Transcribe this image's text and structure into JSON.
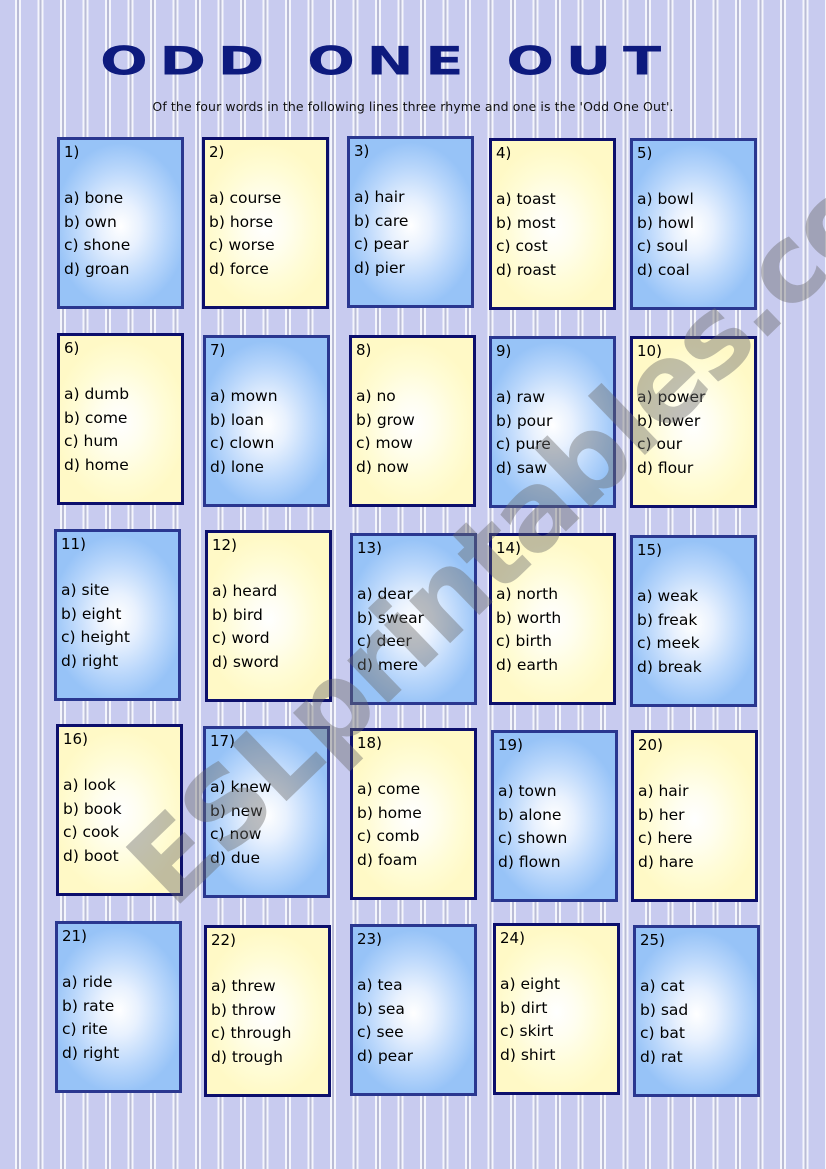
{
  "header": {
    "title": "ODD ONE OUT",
    "instructions": "Of the four words in the following lines three rhyme and one is the 'Odd One Out'."
  },
  "colors": {
    "title": "#0d1a7e",
    "blue_card_border": "#2a3790",
    "yellow_card_border": "#0c0f6c",
    "blue_card_fill": "#97c3f7",
    "yellow_card_fill": "#fff9c6",
    "background": "#c8cbef"
  },
  "watermark": "ESLprintables.com",
  "cards": [
    {
      "number": "1)",
      "style": "blue",
      "options": [
        "a) bone",
        "b) own",
        "c) shone",
        "d) groan"
      ]
    },
    {
      "number": "2)",
      "style": "yellow",
      "options": [
        "a) course",
        "b) horse",
        "c) worse",
        "d) force"
      ]
    },
    {
      "number": "3)",
      "style": "blue",
      "options": [
        "a) hair",
        "b) care",
        "c) pear",
        "d) pier"
      ]
    },
    {
      "number": "4)",
      "style": "yellow",
      "options": [
        "a) toast",
        "b) most",
        "c) cost",
        "d) roast"
      ]
    },
    {
      "number": "5)",
      "style": "blue",
      "options": [
        "a) bowl",
        "b) howl",
        "c) soul",
        "d) coal"
      ]
    },
    {
      "number": "6)",
      "style": "yellow",
      "options": [
        "a) dumb",
        "b) come",
        "c) hum",
        "d) home"
      ]
    },
    {
      "number": "7)",
      "style": "blue",
      "options": [
        "a) mown",
        "b) loan",
        "c) clown",
        "d) lone"
      ]
    },
    {
      "number": "8)",
      "style": "yellow",
      "options": [
        "a) no",
        "b) grow",
        "c) mow",
        "d) now"
      ]
    },
    {
      "number": "9)",
      "style": "blue",
      "options": [
        "a) raw",
        "b) pour",
        "c) pure",
        "d) saw"
      ]
    },
    {
      "number": "10)",
      "style": "yellow",
      "options": [
        "a) power",
        "b) lower",
        "c) our",
        "d) flour"
      ]
    },
    {
      "number": "11)",
      "style": "blue",
      "options": [
        "a) site",
        "b) eight",
        "c) height",
        "d) right"
      ]
    },
    {
      "number": "12)",
      "style": "yellow",
      "options": [
        "a) heard",
        "b) bird",
        "c) word",
        "d) sword"
      ]
    },
    {
      "number": "13)",
      "style": "blue",
      "options": [
        "a) dear",
        "b) swear",
        "c) deer",
        "d) mere"
      ]
    },
    {
      "number": "14)",
      "style": "yellow",
      "options": [
        "a) north",
        "b) worth",
        "c) birth",
        "d) earth"
      ]
    },
    {
      "number": "15)",
      "style": "blue",
      "options": [
        "a) weak",
        "b) freak",
        "c) meek",
        "d) break"
      ]
    },
    {
      "number": "16)",
      "style": "yellow",
      "options": [
        "a) look",
        "b) book",
        "c) cook",
        "d) boot"
      ]
    },
    {
      "number": "17)",
      "style": "blue",
      "options": [
        "a) knew",
        "b) new",
        "c) now",
        "d) due"
      ]
    },
    {
      "number": "18)",
      "style": "yellow",
      "options": [
        "a) come",
        "b) home",
        "c) comb",
        "d) foam"
      ]
    },
    {
      "number": "19)",
      "style": "blue",
      "options": [
        "a) town",
        "b) alone",
        "c) shown",
        "d) flown"
      ]
    },
    {
      "number": "20)",
      "style": "yellow",
      "options": [
        "a) hair",
        "b) her",
        "c) here",
        "d) hare"
      ]
    },
    {
      "number": "21)",
      "style": "blue",
      "options": [
        "a) ride",
        "b) rate",
        "c) rite",
        "d) right"
      ]
    },
    {
      "number": "22)",
      "style": "yellow",
      "options": [
        "a) threw",
        "b) throw",
        "c) through",
        "d) trough"
      ]
    },
    {
      "number": "23)",
      "style": "blue",
      "options": [
        "a) tea",
        "b) sea",
        "c) see",
        "d) pear"
      ]
    },
    {
      "number": "24)",
      "style": "yellow",
      "options": [
        "a) eight",
        "b) dirt",
        "c) skirt",
        "d) shirt"
      ]
    },
    {
      "number": "25)",
      "style": "blue",
      "options": [
        "a) cat",
        "b) sad",
        "c) bat",
        "d) rat"
      ]
    }
  ]
}
